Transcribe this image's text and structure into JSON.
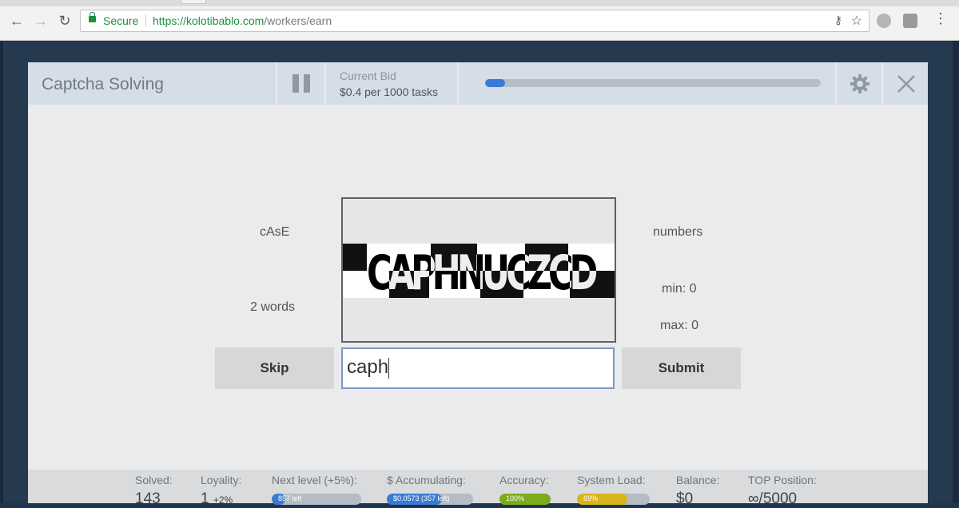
{
  "browser": {
    "secure_label": "Secure",
    "url_host": "https://kolotibablo.com",
    "url_path": "/workers/earn",
    "back_glyph": "←",
    "forward_glyph": "→",
    "reload_glyph": "↻",
    "key_glyph": "⚷",
    "star_glyph": "☆",
    "menu_glyph": "⋮"
  },
  "header": {
    "title": "Captcha Solving",
    "bid_label": "Current Bid",
    "bid_value": "$0.4 per 1000 tasks",
    "progress_fraction": 0.06
  },
  "task": {
    "case_hint": "cAsE",
    "words_hint": "2 words",
    "numbers_hint": "numbers",
    "min_hint": "min: 0",
    "max_hint": "max: 0",
    "captcha_text": "CAPHNUCZCD",
    "skip_label": "Skip",
    "submit_label": "Submit",
    "answer_value": "caph"
  },
  "stats": [
    {
      "label": "Solved:",
      "value": "143"
    },
    {
      "label": "Loyality:",
      "value": "1",
      "suffix": "+2%"
    },
    {
      "label": "Next level (+5%):",
      "bar_text": "857 left",
      "bar_fraction": 0.15,
      "bar_color": "#3a7bd5"
    },
    {
      "label": "$ Accumulating:",
      "bar_text": "$0.0573 (357 left)",
      "bar_fraction": 0.64,
      "bar_color": "#3a7bd5"
    },
    {
      "label": "Accuracy:",
      "bar_text": "100%",
      "bar_fraction": 1.0,
      "bar_color": "#7cac1a"
    },
    {
      "label": "System Load:",
      "bar_text": "69%",
      "bar_fraction": 0.69,
      "bar_color": "#d8b51a"
    },
    {
      "label": "Balance:",
      "value": "$0"
    },
    {
      "label": "TOP Position:",
      "value": "∞/5000"
    }
  ]
}
